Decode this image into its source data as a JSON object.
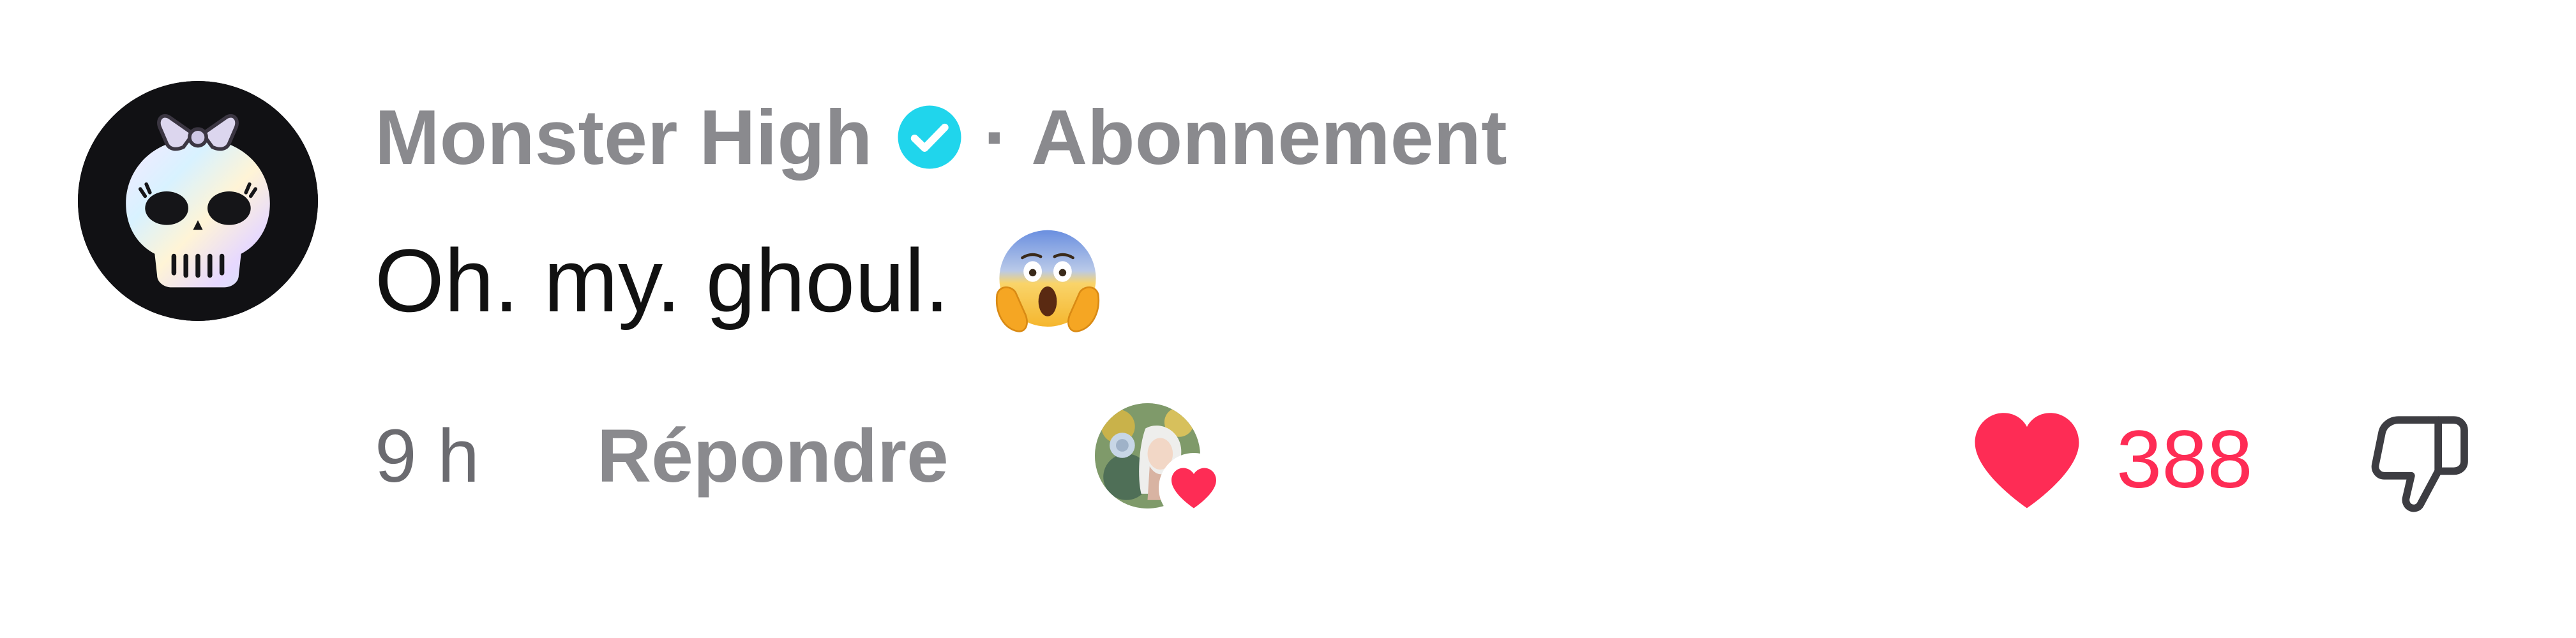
{
  "comment": {
    "author": {
      "name": "Monster High",
      "verified_icon": "verified-badge-icon",
      "separator": "·",
      "follow_status": "Abonnement",
      "avatar_icon": "monster-high-skull-logo"
    },
    "text": "Oh. my. ghoul.",
    "emoji": "face-screaming-in-fear",
    "footer": {
      "time": "9 h",
      "reply_label": "Répondre",
      "creator_liked_icon": "heart-icon",
      "likes": "388",
      "like_icon": "heart-icon",
      "dislike_icon": "thumbs-down-icon"
    }
  },
  "colors": {
    "accent_like": "#fe2c55",
    "verified": "#20d5ec",
    "muted_text": "#8a8a8e",
    "body_text": "#111111"
  }
}
